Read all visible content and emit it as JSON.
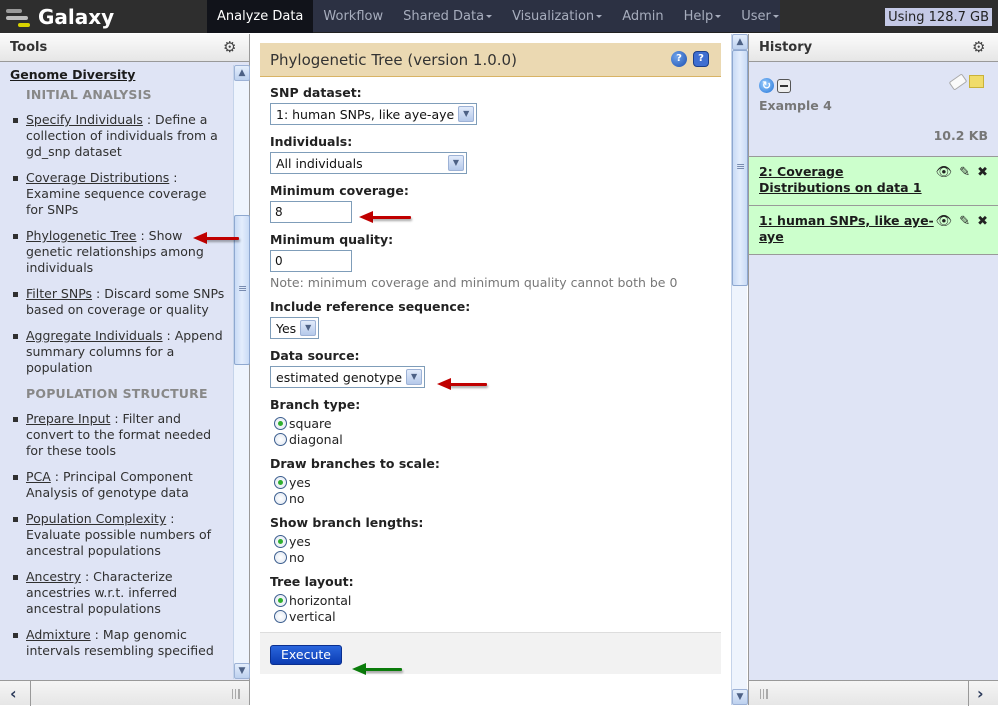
{
  "masthead": {
    "brand": "Galaxy",
    "nav": [
      {
        "label": "Analyze Data",
        "active": true,
        "dropdown": false
      },
      {
        "label": "Workflow",
        "active": false,
        "dropdown": false
      },
      {
        "label": "Shared Data",
        "active": false,
        "dropdown": true
      },
      {
        "label": "Visualization",
        "active": false,
        "dropdown": true
      },
      {
        "label": "Admin",
        "active": false,
        "dropdown": false
      },
      {
        "label": "Help",
        "active": false,
        "dropdown": true
      },
      {
        "label": "User",
        "active": false,
        "dropdown": true
      }
    ],
    "quota": "Using 128.7 GB"
  },
  "tools": {
    "title": "Tools",
    "section": "Genome Diversity",
    "groups": [
      {
        "label": "INITIAL ANALYSIS",
        "items": [
          {
            "name": "Specify Individuals",
            "desc": " : Define a collection of individuals from a gd_snp dataset"
          },
          {
            "name": "Coverage Distributions",
            "desc": " : Examine sequence coverage for SNPs"
          },
          {
            "name": "Phylogenetic Tree",
            "desc": " : Show genetic relationships among individuals"
          },
          {
            "name": "Filter SNPs",
            "desc": " : Discard some SNPs based on coverage or quality"
          },
          {
            "name": "Aggregate Individuals",
            "desc": " : Append summary columns for a population"
          }
        ]
      },
      {
        "label": "POPULATION STRUCTURE",
        "items": [
          {
            "name": "Prepare Input",
            "desc": " : Filter and convert to the format needed for these tools"
          },
          {
            "name": "PCA",
            "desc": " : Principal Component Analysis of genotype data"
          },
          {
            "name": "Population Complexity",
            "desc": " : Evaluate possible numbers of ancestral populations"
          },
          {
            "name": "Ancestry",
            "desc": " : Characterize ancestries w.r.t. inferred ancestral populations"
          },
          {
            "name": "Admixture",
            "desc": " : Map genomic intervals resembling specified"
          }
        ]
      }
    ]
  },
  "form": {
    "title": "Phylogenetic Tree (version 1.0.0)",
    "snp_dataset": {
      "label": "SNP dataset:",
      "value": "1: human SNPs, like aye-aye"
    },
    "individuals": {
      "label": "Individuals:",
      "value": "All individuals"
    },
    "min_coverage": {
      "label": "Minimum coverage:",
      "value": "8"
    },
    "min_quality": {
      "label": "Minimum quality:",
      "value": "0",
      "note": "Note: minimum coverage and minimum quality cannot both be 0"
    },
    "include_ref": {
      "label": "Include reference sequence:",
      "value": "Yes"
    },
    "data_source": {
      "label": "Data source:",
      "value": "estimated genotype"
    },
    "branch_type": {
      "label": "Branch type:",
      "options": [
        "square",
        "diagonal"
      ],
      "selected": "square"
    },
    "draw_scale": {
      "label": "Draw branches to scale:",
      "options": [
        "yes",
        "no"
      ],
      "selected": "yes"
    },
    "show_lengths": {
      "label": "Show branch lengths:",
      "options": [
        "yes",
        "no"
      ],
      "selected": "yes"
    },
    "tree_layout": {
      "label": "Tree layout:",
      "options": [
        "horizontal",
        "vertical"
      ],
      "selected": "horizontal"
    },
    "execute": "Execute"
  },
  "history": {
    "title": "History",
    "name": "Example 4",
    "size": "10.2 KB",
    "datasets": [
      {
        "title": "2: Coverage Distributions on data 1"
      },
      {
        "title": "1: human SNPs, like aye-aye"
      }
    ]
  },
  "colors": {
    "masthead": "#2c3143",
    "panel_bg": "#dfe4f5",
    "form_header": "#ebd9b2",
    "dataset_ok": "#ccffcc",
    "annotation_red": "#c00000",
    "annotation_green": "#0b7c0b",
    "execute_button": "#0b3cb3"
  }
}
